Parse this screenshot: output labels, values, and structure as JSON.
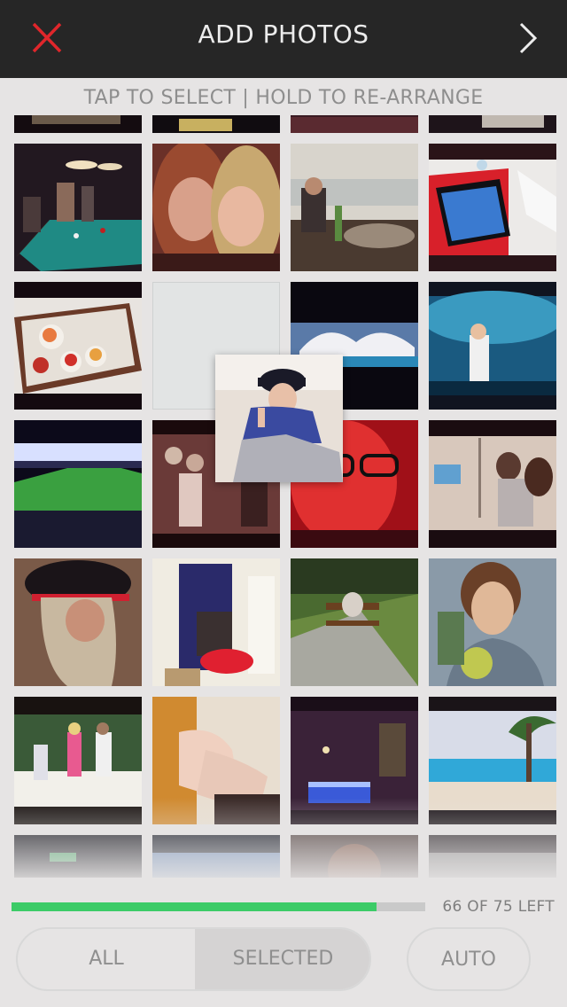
{
  "header": {
    "title": "ADD PHOTOS",
    "close_icon": "close-x-icon",
    "next_icon": "chevron-right-icon",
    "accent_close": "#e0262b"
  },
  "hint": "TAP TO SELECT | HOLD TO RE-ARRANGE",
  "progress": {
    "fraction": 0.883,
    "label": "66 OF 75 LEFT",
    "fill_color": "#3ccb67"
  },
  "filter": {
    "all_label": "ALL",
    "selected_label": "SELECTED",
    "active": "SELECTED"
  },
  "auto_label": "AUTO",
  "photos": [
    "partial-top-1",
    "partial-top-2",
    "partial-top-3",
    "partial-top-4",
    "pool-table-bar",
    "two-girls-selfie",
    "cafe-harbor",
    "ipad-on-desk",
    "breakfast-tray",
    "empty-slot",
    "science-city-building",
    "aquarium-tunnel",
    "stadium-night",
    "party-crowd",
    "red-lit-glasses",
    "dorm-room-girls",
    "ny-cap-girl",
    "doorway-luggage",
    "park-bench-sleeper",
    "coconut-drink",
    "garden-friends",
    "painted-nails",
    "night-pool-terrace",
    "beach-pool-palms",
    "partial-bottom-1",
    "partial-bottom-2",
    "partial-bottom-3",
    "partial-bottom-4"
  ],
  "dragged_photo": "girl-cap-peace-sign"
}
